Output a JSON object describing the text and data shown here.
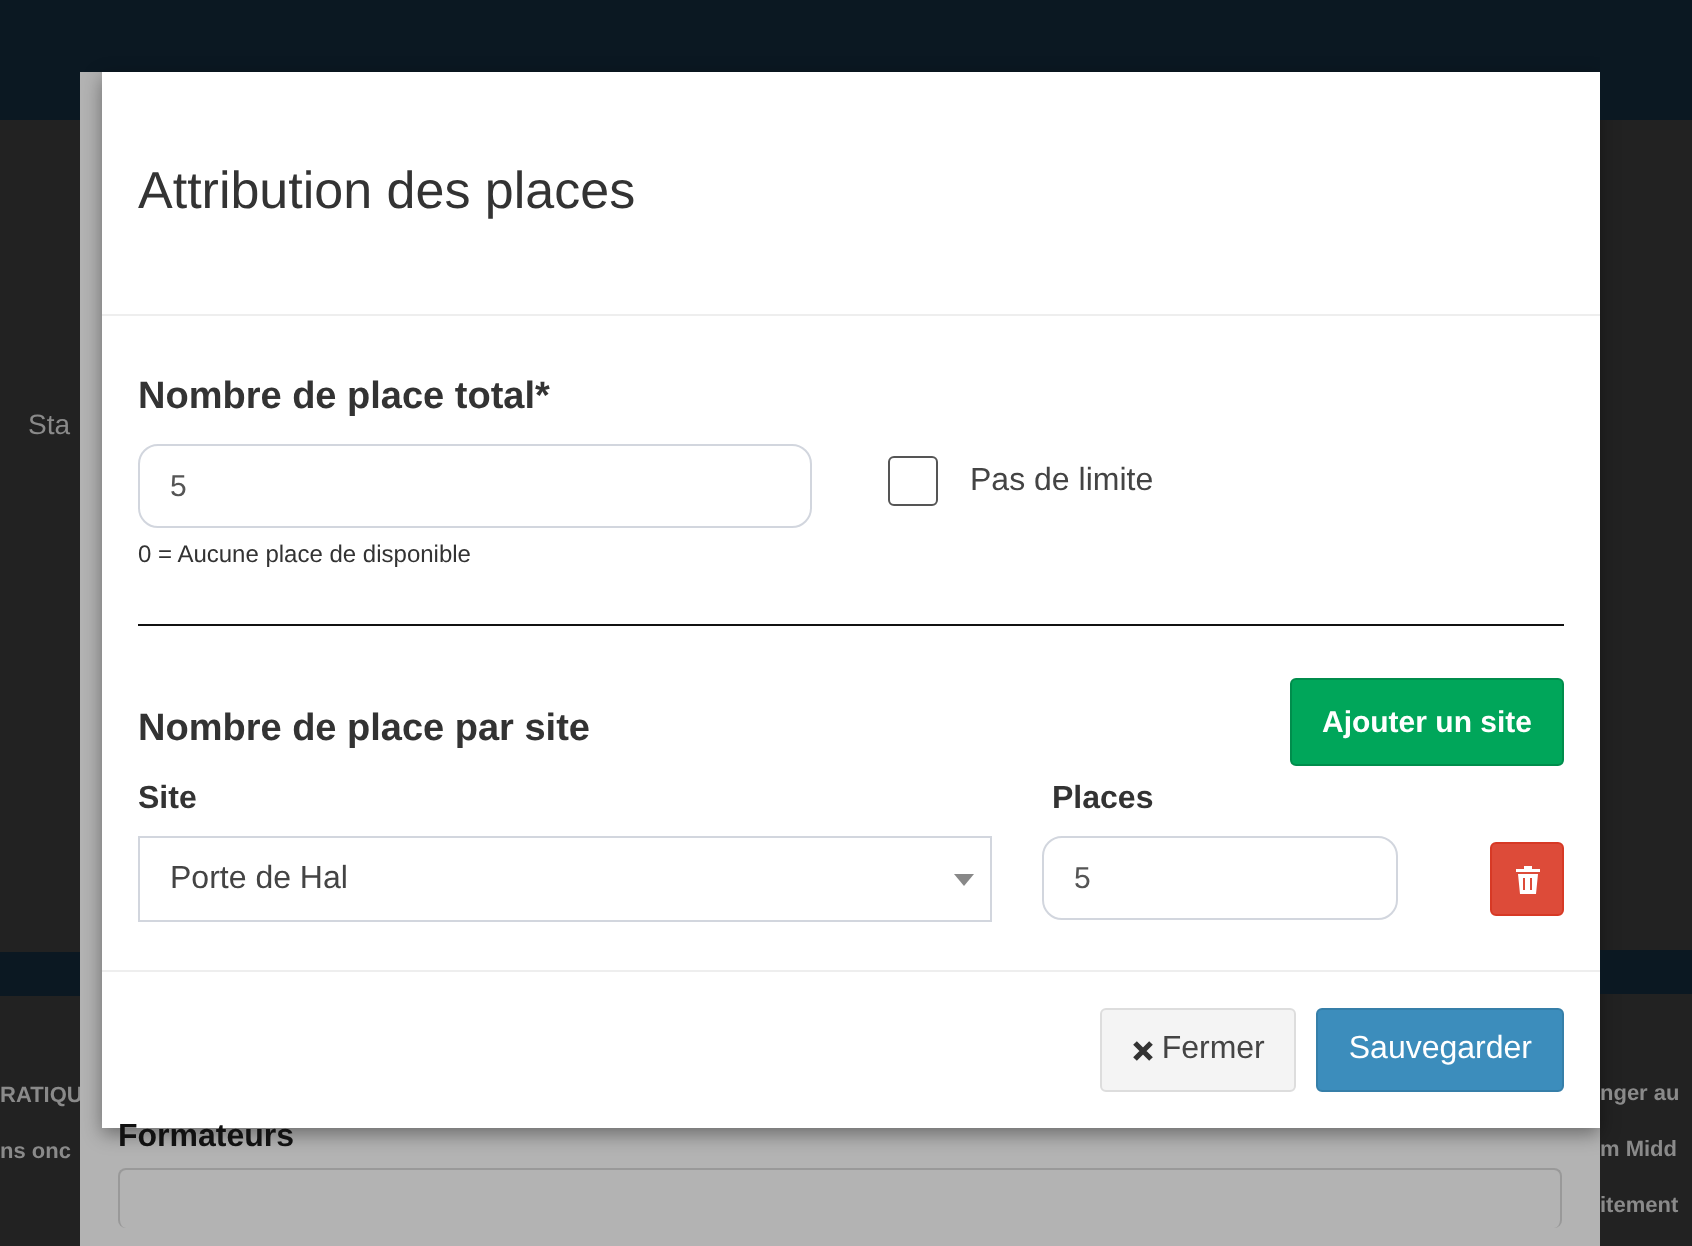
{
  "background": {
    "fragments_left": [
      "Sta",
      "RATIQU",
      "ns onc"
    ],
    "section_heading": "Formateurs",
    "fragments_right": [
      "nger au",
      "m Midd",
      "itement"
    ]
  },
  "modal": {
    "title": "Attribution des places",
    "total": {
      "label": "Nombre de place total*",
      "value": "5",
      "help": "0 = Aucune place de disponible"
    },
    "no_limit": {
      "label": "Pas de limite",
      "checked": false
    },
    "per_site": {
      "title": "Nombre de place par site",
      "add_button": "Ajouter un site",
      "columns": [
        "Site",
        "Places"
      ],
      "rows": [
        {
          "site": "Porte de Hal",
          "places": "5"
        }
      ]
    },
    "buttons": [
      {
        "kind": "close",
        "label": "Fermer"
      },
      {
        "kind": "save",
        "label": "Sauvegarder"
      }
    ]
  }
}
